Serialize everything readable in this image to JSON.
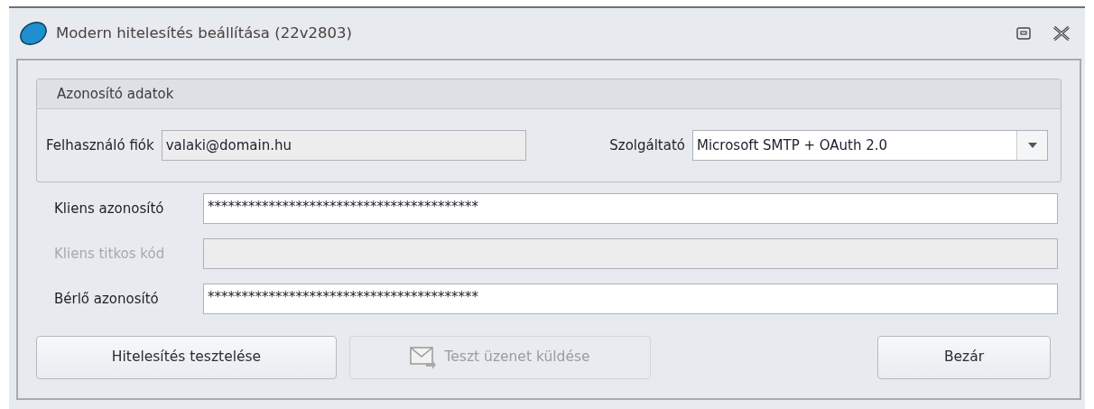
{
  "window": {
    "title": "Modern hitelesítés beállítása (22v2803)"
  },
  "group": {
    "title": "Azonosító adatok",
    "account": {
      "label": "Felhasználó fiók",
      "value": "valaki@domain.hu",
      "disabled": true
    },
    "provider": {
      "label": "Szolgáltató",
      "value": "Microsoft SMTP + OAuth 2.0"
    }
  },
  "fields": [
    {
      "label": "Kliens azonosító",
      "value": "****************************************",
      "disabled": false
    },
    {
      "label": "Kliens titkos kód",
      "disabled": true
    },
    {
      "label": "Bérlő azonosító",
      "value": "****************************************",
      "disabled": false
    }
  ],
  "buttons": [
    {
      "label": "Hitelesítés tesztelése",
      "disabled": false,
      "kind": "plain"
    },
    {
      "label": "Teszt üzenet küldése",
      "disabled": true,
      "kind": "mail"
    },
    {
      "label": "Bezár",
      "disabled": false,
      "kind": "plain"
    }
  ]
}
